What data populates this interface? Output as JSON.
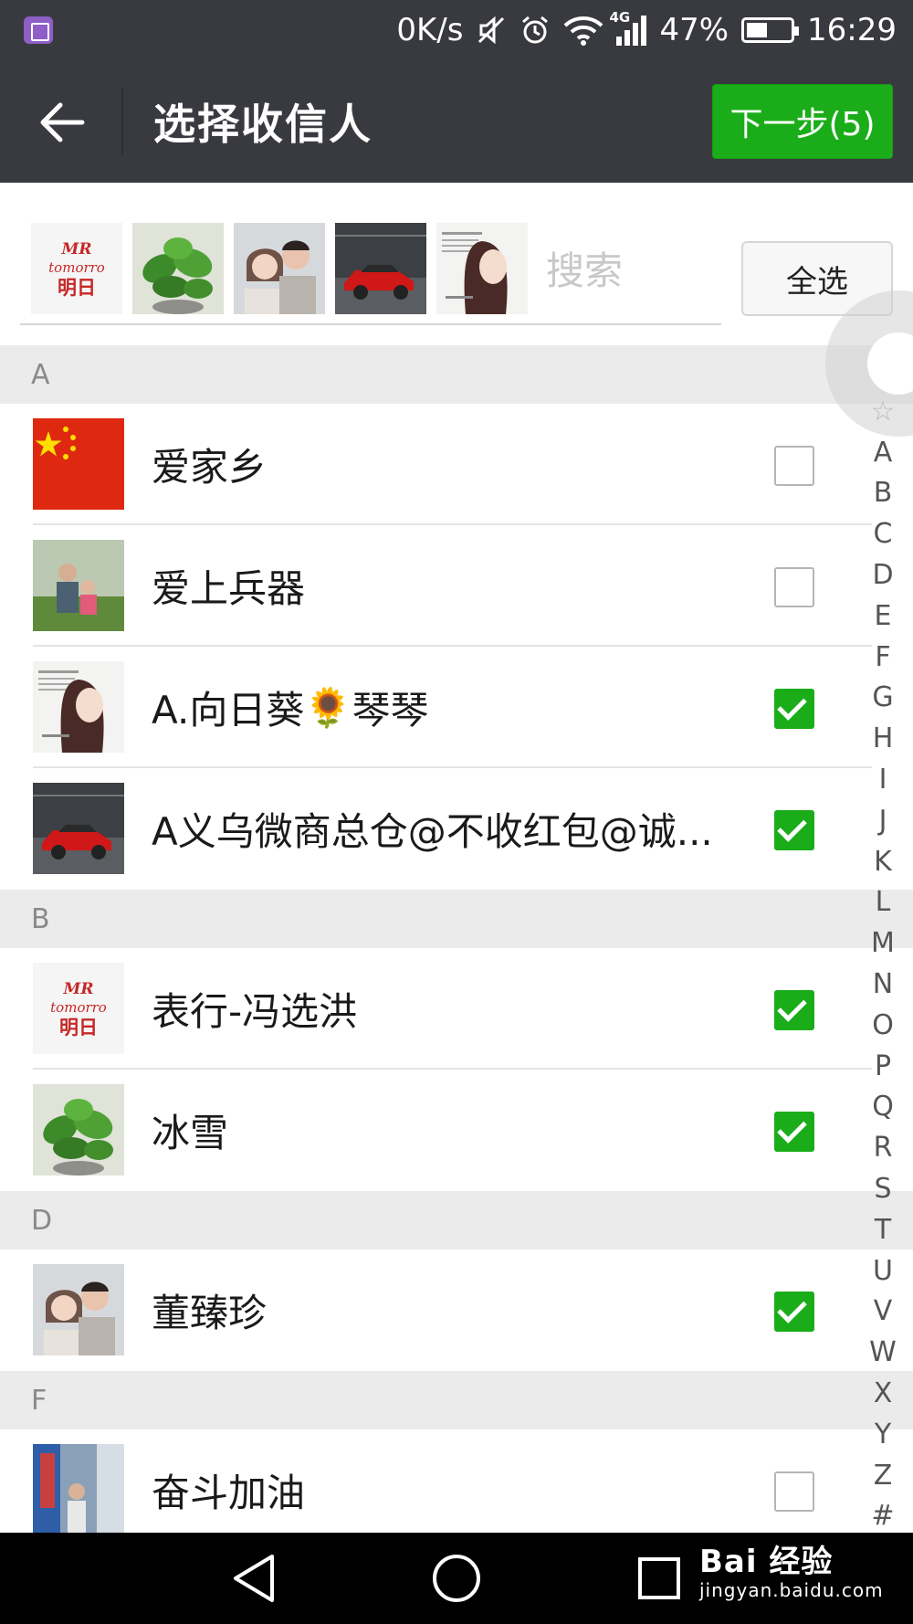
{
  "status_bar": {
    "net_speed": "0K/s",
    "network_type": "4G",
    "battery_level": "47%",
    "time": "16:29"
  },
  "header": {
    "title": "选择收信人",
    "next_button": "下一步(5)"
  },
  "selection": {
    "search_placeholder": "搜索",
    "select_all": "全选",
    "mr_logo": {
      "line1": "MR",
      "line2": "tomorro",
      "line3": "明日"
    }
  },
  "sections": [
    {
      "letter": "A",
      "contacts": [
        {
          "name": "爱家乡",
          "checked": false
        },
        {
          "name": "爱上兵器",
          "checked": false
        },
        {
          "name_prefix": "A.向日葵",
          "emoji": "🌻",
          "name_suffix": " 琴琴",
          "checked": true
        },
        {
          "name": "A义乌微商总仓@不收红包@诚...",
          "checked": true
        }
      ]
    },
    {
      "letter": "B",
      "contacts": [
        {
          "name": "表行-冯选洪",
          "checked": true
        },
        {
          "name": "冰雪",
          "checked": true
        }
      ]
    },
    {
      "letter": "D",
      "contacts": [
        {
          "name": "董臻珍",
          "checked": true
        }
      ]
    },
    {
      "letter": "F",
      "contacts": [
        {
          "name": "奋斗加油",
          "checked": false
        }
      ]
    }
  ],
  "index_letters": [
    "☆",
    "A",
    "B",
    "C",
    "D",
    "E",
    "F",
    "G",
    "H",
    "I",
    "J",
    "K",
    "L",
    "M",
    "N",
    "O",
    "P",
    "Q",
    "R",
    "S",
    "T",
    "U",
    "V",
    "W",
    "X",
    "Y",
    "Z",
    "#"
  ],
  "watermark": {
    "main": "Bai  经验",
    "sub": "jingyan.baidu.com"
  },
  "colors": {
    "bar": "#393a3f",
    "accent": "#1aad19",
    "section_bg": "#ebebeb"
  }
}
